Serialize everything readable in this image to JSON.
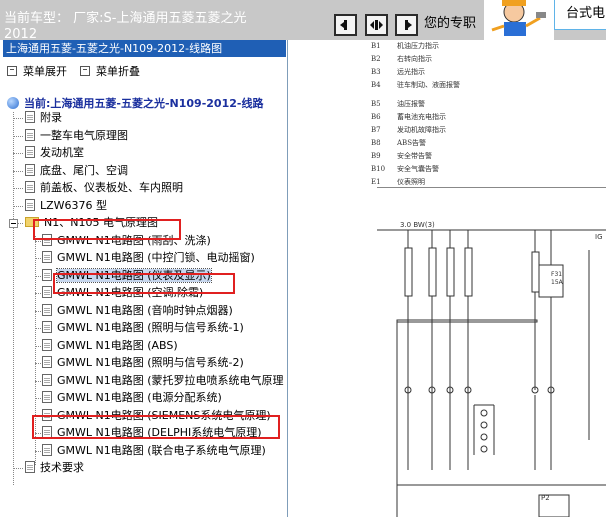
{
  "header": {
    "current_car_line1": "当前车型：  厂家:S-上海通用五菱五菱之光",
    "current_car_line2": "2012",
    "promo_text": "您的专职",
    "ad_text": "台式电",
    "buttons": [
      {
        "name": "prev-button",
        "icon": "arrow-left-icon"
      },
      {
        "name": "both-button",
        "icon": "double-arrow-icon"
      },
      {
        "name": "next-button",
        "icon": "arrow-right-icon"
      }
    ]
  },
  "tree": {
    "title": "上海通用五菱-五菱之光-N109-2012-线路图",
    "expand_label": "菜单展开",
    "collapse_label": "菜单折叠",
    "root_label": "当前:上海通用五菱-五菱之光-N109-2012-线路",
    "items": [
      {
        "label": "附录",
        "type": "doc",
        "level": 1
      },
      {
        "label": "一整车电气原理图",
        "type": "doc",
        "level": 1
      },
      {
        "label": "发动机室",
        "type": "doc",
        "level": 1
      },
      {
        "label": "底盘、尾门、空调",
        "type": "doc",
        "level": 1
      },
      {
        "label": "前盖板、仪表板处、车内照明",
        "type": "doc",
        "level": 1
      },
      {
        "label": "LZW6376 型",
        "type": "doc",
        "level": 1
      },
      {
        "label": "N1、N105 电气原理图",
        "type": "folder",
        "level": 1,
        "highlighted": true
      },
      {
        "label": "GMWL N1电路图 (雨刮、洗涤)",
        "type": "doc",
        "level": 2
      },
      {
        "label": "GMWL N1电路图 (中控门锁、电动摇窗)",
        "type": "doc",
        "level": 2
      },
      {
        "label": "GMWL N1电路图 (仪表及显示)",
        "type": "doc",
        "level": 2,
        "selected": true,
        "highlighted": true
      },
      {
        "label": "GMWL N1电路图 (空调,除霜)",
        "type": "doc",
        "level": 2
      },
      {
        "label": "GMWL N1电路图 (音响时钟点烟器)",
        "type": "doc",
        "level": 2
      },
      {
        "label": "GMWL N1电路图 (照明与信号系统-1)",
        "type": "doc",
        "level": 2
      },
      {
        "label": "GMWL N1电路图 (ABS)",
        "type": "doc",
        "level": 2
      },
      {
        "label": "GMWL N1电路图 (照明与信号系统-2)",
        "type": "doc",
        "level": 2
      },
      {
        "label": "GMWL N1电路图 (蒙托罗拉电喷系统电气原理",
        "type": "doc",
        "level": 2
      },
      {
        "label": "GMWL N1电路图 (电源分配系统)",
        "type": "doc",
        "level": 2
      },
      {
        "label": "GMWL N1电路图 (SIEMENS系统电气原理)",
        "type": "doc",
        "level": 2,
        "highlighted": true
      },
      {
        "label": "GMWL N1电路图 (DELPHI系统电气原理)",
        "type": "doc",
        "level": 2
      },
      {
        "label": "GMWL N1电路图 (联合电子系统电气原理)",
        "type": "doc",
        "level": 2
      },
      {
        "label": "技术要求",
        "type": "doc",
        "level": 1
      }
    ]
  },
  "diagram": {
    "legend": [
      {
        "code": "B1",
        "text": "机油压力指示"
      },
      {
        "code": "B2",
        "text": "右转向指示"
      },
      {
        "code": "B3",
        "text": "远光指示"
      },
      {
        "code": "B4",
        "text": "驻车制动、液面报警"
      },
      {
        "code": "B5",
        "text": "油压报警"
      },
      {
        "code": "B6",
        "text": "蓄电池充电指示"
      },
      {
        "code": "B7",
        "text": "发动机故障指示"
      },
      {
        "code": "B8",
        "text": "ABS告警"
      },
      {
        "code": "B9",
        "text": "安全带告警"
      },
      {
        "code": "B10",
        "text": "安全气囊告警"
      },
      {
        "code": "E1",
        "text": "仪表照明"
      }
    ],
    "wire_label": "3.0 BW(3)",
    "label_ig": "IG",
    "fuse_label": "F31",
    "fuse_rating": "15A",
    "label_p2": "P2"
  }
}
